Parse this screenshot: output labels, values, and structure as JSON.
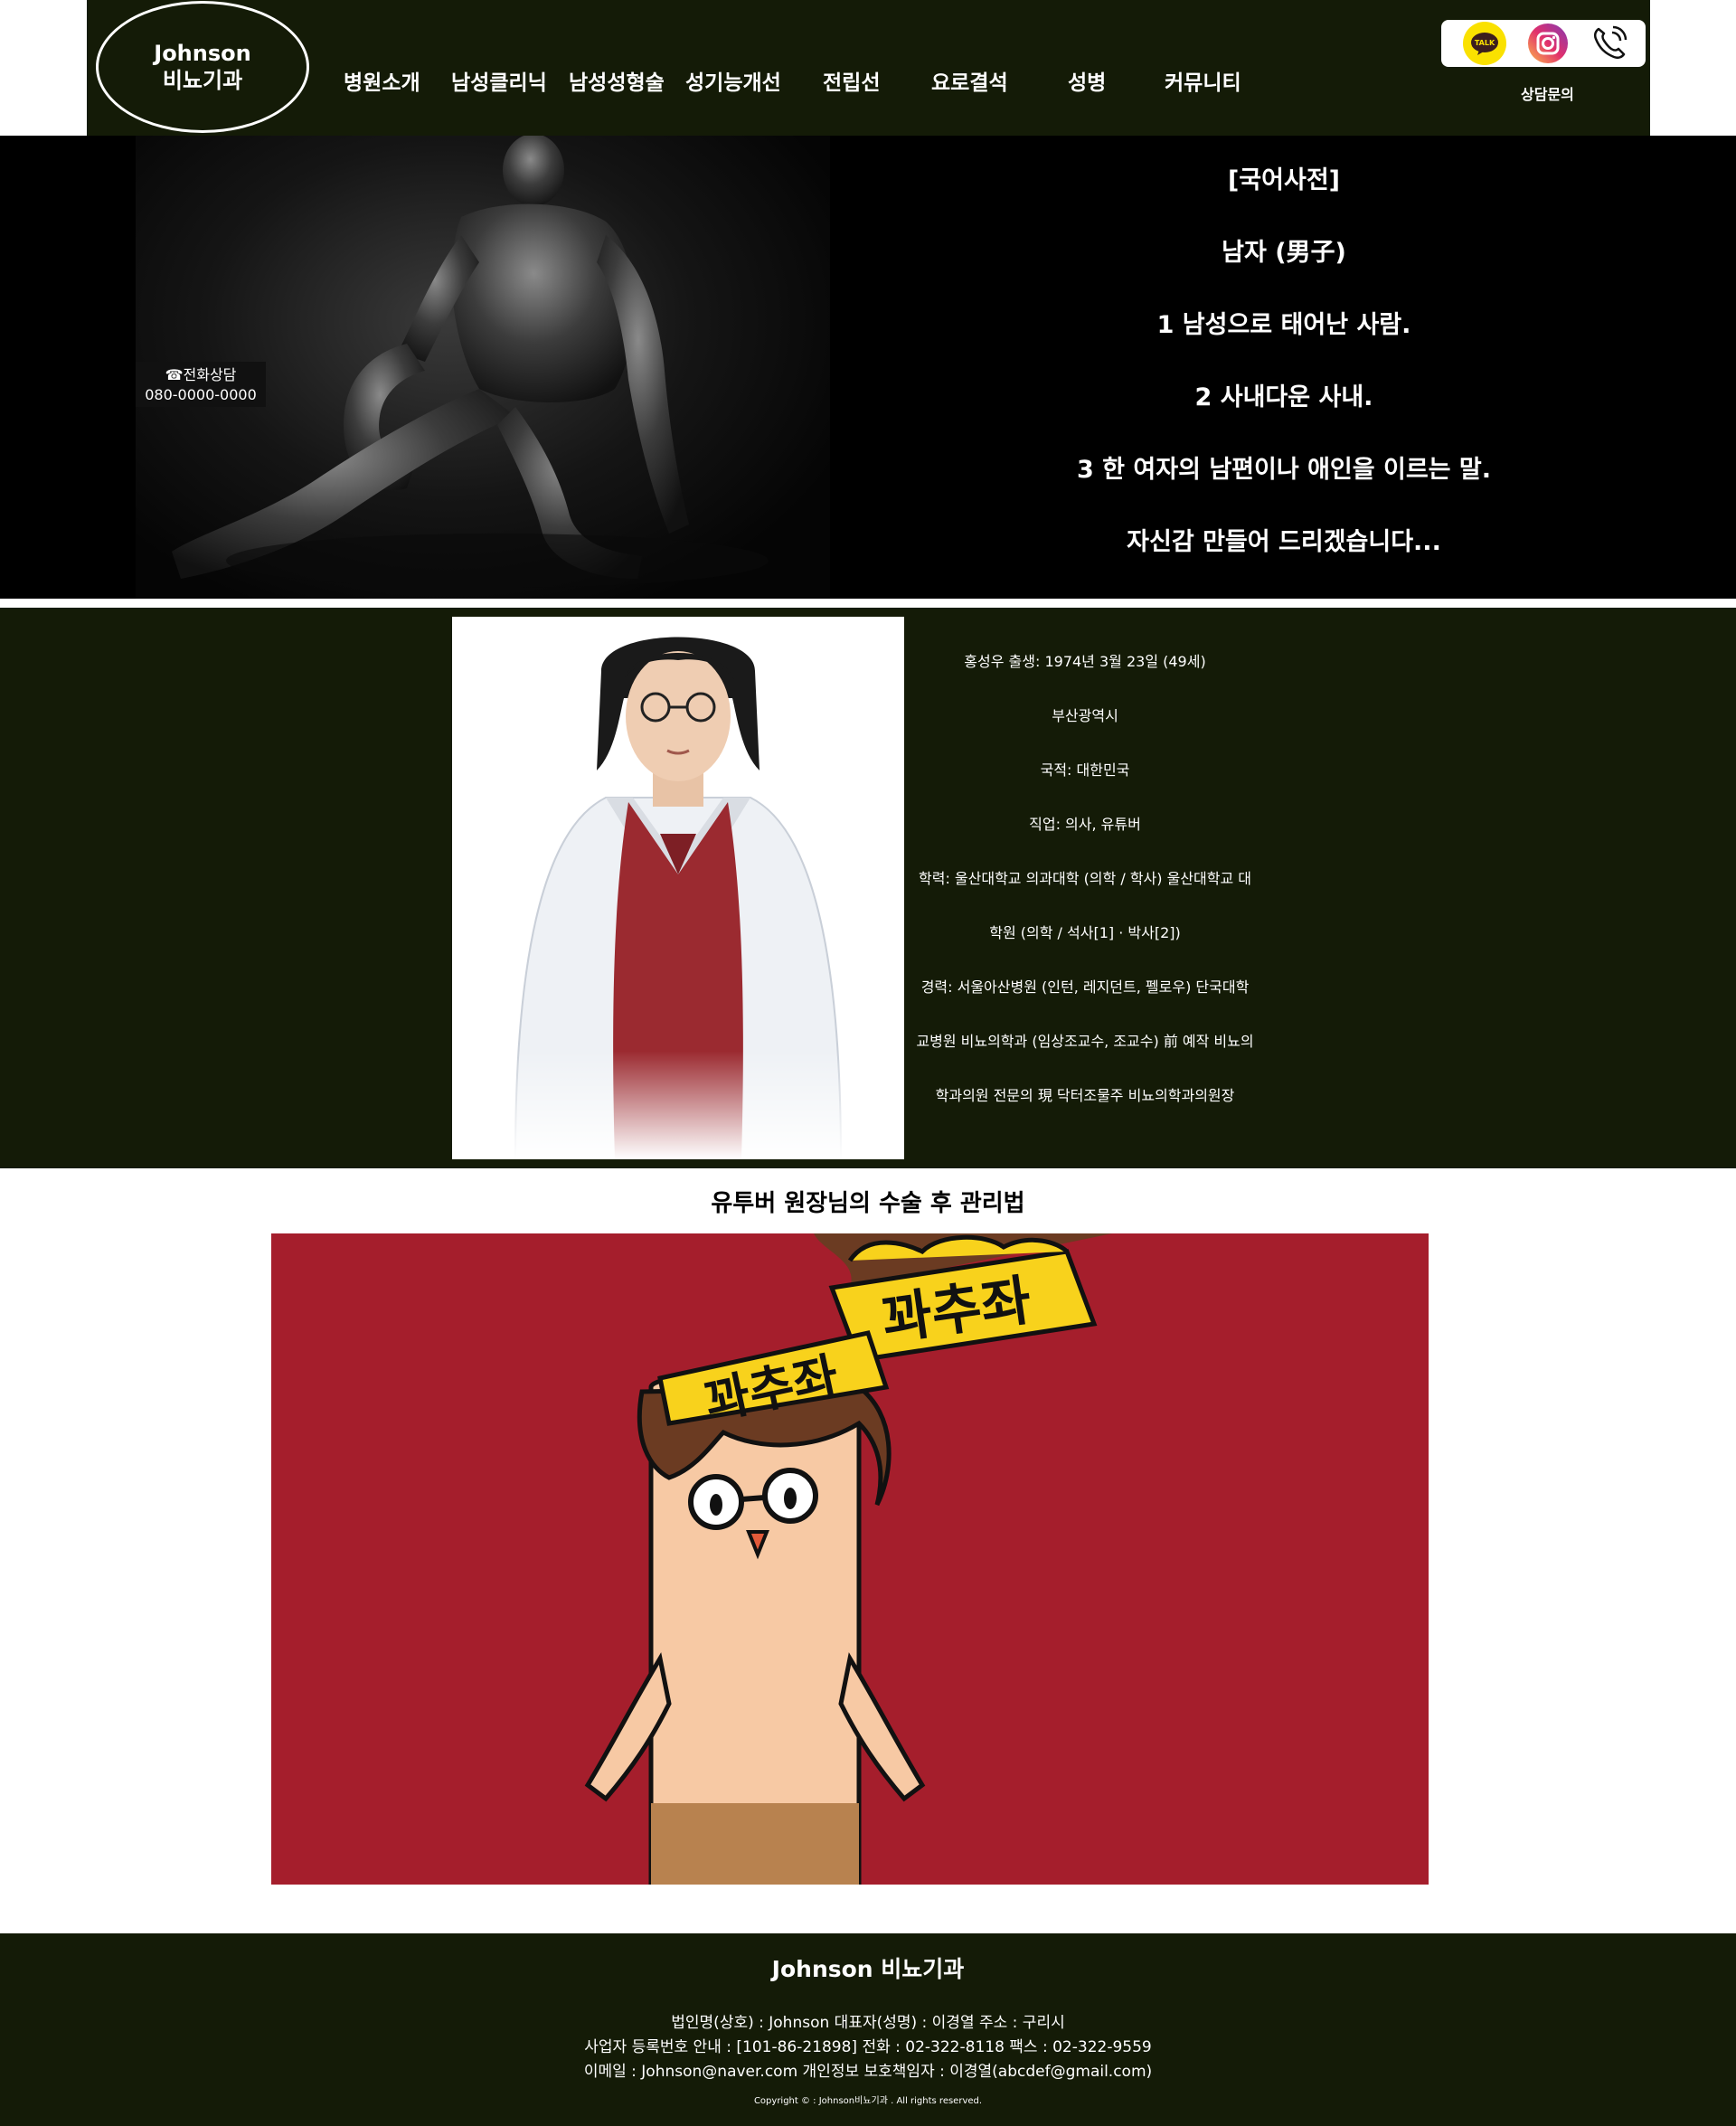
{
  "header": {
    "logo_line1": "Johnson",
    "logo_line2": "비뇨기과",
    "nav": [
      "병원소개",
      "남성클리닉",
      "남성성형술",
      "성기능개선",
      "전립선",
      "요로결석",
      "성병",
      "커뮤니티"
    ],
    "social": {
      "kakao_text": "TALK"
    },
    "consult_label": "상담문의"
  },
  "hero": {
    "phone_label": "☎전화상담",
    "phone_number": "080-0000-0000",
    "dictionary": [
      "[국어사전]",
      "남자 (男子)",
      "1 남성으로 태어난 사람.",
      "2 사내다운 사내.",
      "3 한 여자의 남편이나 애인을 이르는 말.",
      "자신감 만들어 드리겠습니다..."
    ]
  },
  "doctor": {
    "bio": [
      "홍성우 출생: 1974년 3월 23일 (49세)",
      "부산광역시",
      "국적: 대한민국",
      "직업: 의사, 유튜버",
      "학력: 울산대학교 의과대학 (의학 / 학사) 울산대학교 대",
      "학원 (의학 / 석사[1] · 박사[2])",
      "경력: 서울아산병원 (인턴, 레지던트, 펠로우) 단국대학",
      "교병원 비뇨의학과 (임상조교수, 조교수) 前 예작 비뇨의",
      "학과의원 전문의 現 닥터조물주 비뇨의학과의원장"
    ]
  },
  "video": {
    "title": "유투버 원장님의 수술 후 관리법",
    "crown_text": "꽈추좌"
  },
  "footer": {
    "title": "Johnson 비뇨기과",
    "line1": "법인명(상호) : Johnson     대표자(성명) : 이경열     주소 : 구리시",
    "line2": "사업자 등록번호 안내 : [101-86-21898]     전화 : 02-322-8118     팩스 : 02-322-9559",
    "line3": "이메일 : Johnson@naver.com     개인정보 보호책임자 : 이경열(abcdef@gmail.com)",
    "copyright": "Copyright ©    : Johnson비뇨기과 . All rights reserved."
  }
}
